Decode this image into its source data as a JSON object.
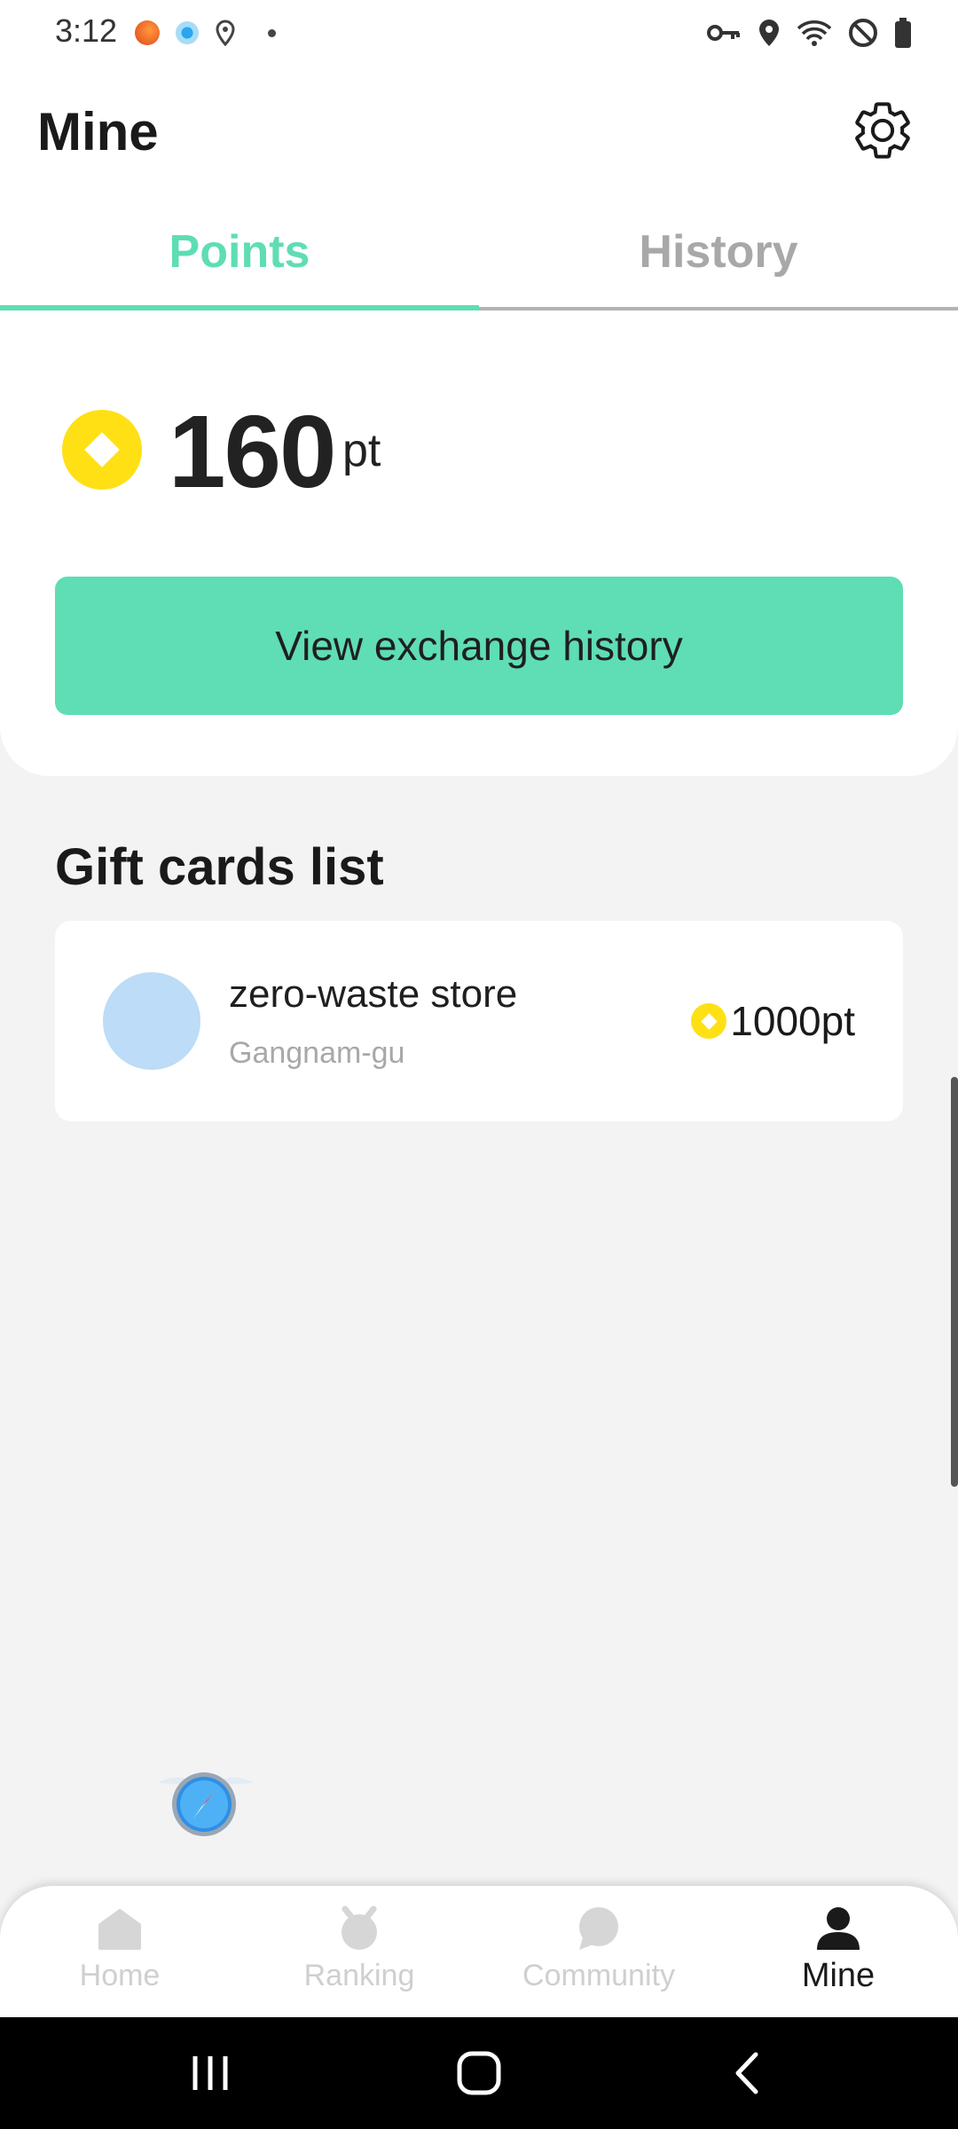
{
  "status_bar": {
    "time": "3:12"
  },
  "header": {
    "title": "Mine"
  },
  "tabs": [
    {
      "label": "Points",
      "active": true
    },
    {
      "label": "History",
      "active": false
    }
  ],
  "points": {
    "value": "160",
    "unit": "pt",
    "exchange_button_label": "View exchange history"
  },
  "gift_cards": {
    "section_title": "Gift cards list",
    "items": [
      {
        "name": "zero-waste store",
        "location": "Gangnam-gu",
        "price": "1000pt"
      }
    ]
  },
  "bottom_nav": [
    {
      "label": "Home",
      "icon": "home-icon",
      "active": false
    },
    {
      "label": "Ranking",
      "icon": "medal-icon",
      "active": false
    },
    {
      "label": "Community",
      "icon": "chat-icon",
      "active": false
    },
    {
      "label": "Mine",
      "icon": "person-icon",
      "active": true
    }
  ],
  "colors": {
    "accent": "#5fddb5",
    "coin": "#ffe015",
    "background": "#f3f3f3",
    "inactive": "#a8a8a8"
  }
}
